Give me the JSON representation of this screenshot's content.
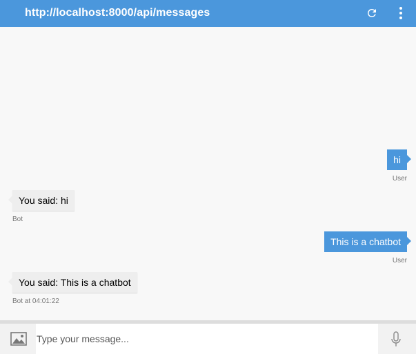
{
  "header": {
    "title": "http://localhost:8000/api/messages",
    "refresh_icon": "refresh-icon",
    "menu_icon": "more-vertical-icon",
    "color": "#4b97dc"
  },
  "messages": [
    {
      "role": "user",
      "text": "hi",
      "meta": "User"
    },
    {
      "role": "bot",
      "text": "You said: hi",
      "meta": "Bot"
    },
    {
      "role": "user",
      "text": "This is a chatbot",
      "meta": "User"
    },
    {
      "role": "bot",
      "text": "You said: This is a chatbot",
      "meta": "Bot at 04:01:22"
    }
  ],
  "composer": {
    "placeholder": "Type your message...",
    "value": "",
    "image_icon": "image-icon",
    "mic_icon": "microphone-icon"
  }
}
